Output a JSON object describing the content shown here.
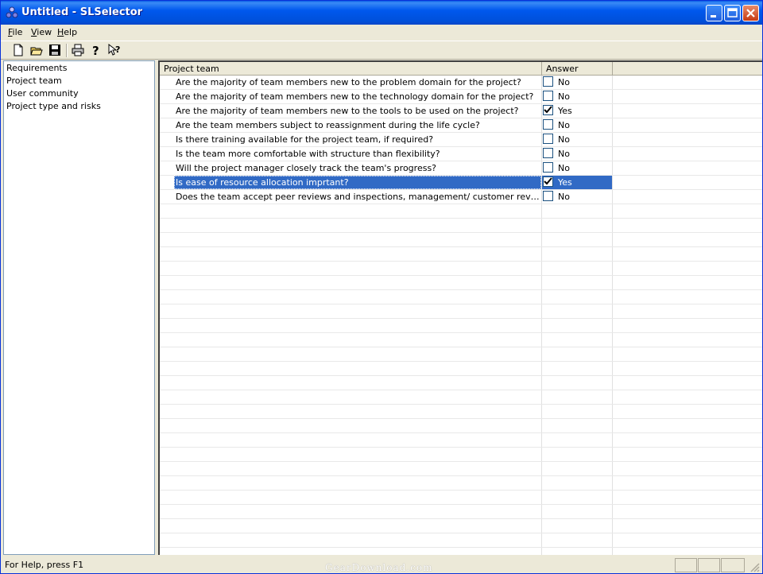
{
  "window": {
    "title": "Untitled - SLSelector"
  },
  "menu": [
    {
      "label": "File",
      "mnemonic": "F",
      "rest": "ile"
    },
    {
      "label": "View",
      "mnemonic": "V",
      "rest": "iew"
    },
    {
      "label": "Help",
      "mnemonic": "H",
      "rest": "elp"
    }
  ],
  "toolbar": [
    "new-document-icon",
    "open-folder-icon",
    "save-disk-icon",
    "print-icon",
    "help-icon",
    "context-help-icon"
  ],
  "sidebar": {
    "items": [
      {
        "label": "Requirements"
      },
      {
        "label": "Project team"
      },
      {
        "label": "User community"
      },
      {
        "label": "Project type and risks"
      }
    ]
  },
  "grid": {
    "columns": {
      "question": "Project team",
      "answer": "Answer"
    },
    "rows": [
      {
        "question": "Are the majority of team members new to the problem domain for the project?",
        "checked": false,
        "answer": "No"
      },
      {
        "question": "Are the majority of team members new to the technology domain for the project?",
        "checked": false,
        "answer": "No"
      },
      {
        "question": "Are the majority of team members new to the tools to be used on the project?",
        "checked": true,
        "answer": "Yes"
      },
      {
        "question": "Are the team members subject to reassignment during the life cycle?",
        "checked": false,
        "answer": "No"
      },
      {
        "question": "Is there training available for the project team, if required?",
        "checked": false,
        "answer": "No"
      },
      {
        "question": "Is the team more comfortable with structure than flexibility?",
        "checked": false,
        "answer": "No"
      },
      {
        "question": "Will the project manager closely track the team's progress?",
        "checked": false,
        "answer": "No"
      },
      {
        "question": "Is ease of resource allocation imprtant?",
        "checked": true,
        "answer": "Yes",
        "selected": true
      },
      {
        "question": "Does the team accept peer reviews and inspections, management/ customer reviews and inspections, and milestone reviews?",
        "checked": false,
        "answer": "No"
      }
    ]
  },
  "status": {
    "text": "For Help, press F1",
    "watermark": "GearDownload.com"
  },
  "colors": {
    "selection": "#316AC5",
    "titlebar": "#0058EE",
    "face": "#ECE9D8"
  }
}
